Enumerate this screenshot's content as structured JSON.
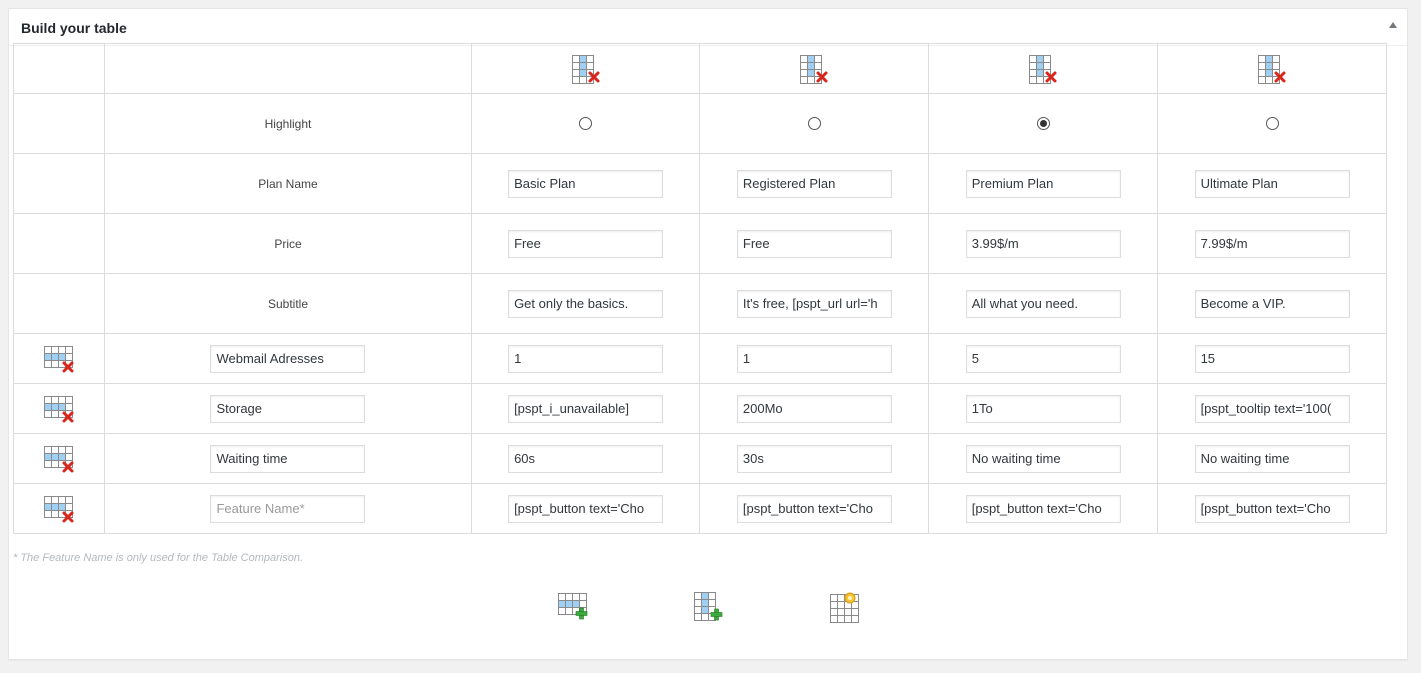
{
  "panel": {
    "title": "Build your table"
  },
  "rows": {
    "highlight": "Highlight",
    "plan_name": "Plan Name",
    "price": "Price",
    "subtitle": "Subtitle"
  },
  "plans": [
    {
      "name": "Basic Plan",
      "price": "Free",
      "subtitle": "Get only the basics.",
      "highlighted": false
    },
    {
      "name": "Registered Plan",
      "price": "Free",
      "subtitle": "It's free, [pspt_url url='h",
      "highlighted": false
    },
    {
      "name": "Premium Plan",
      "price": "3.99$/m",
      "subtitle": "All what you need.",
      "highlighted": true
    },
    {
      "name": "Ultimate Plan",
      "price": "7.99$/m",
      "subtitle": "Become a VIP.",
      "highlighted": false
    }
  ],
  "features": [
    {
      "name": "Webmail Adresses",
      "values": [
        "1",
        "1",
        "5",
        "15"
      ]
    },
    {
      "name": "Storage",
      "values": [
        "[pspt_i_unavailable]",
        "200Mo",
        "1To",
        "[pspt_tooltip text='100("
      ]
    },
    {
      "name": "Waiting time",
      "values": [
        "60s",
        "30s",
        "No waiting time",
        "No waiting time"
      ]
    },
    {
      "name": "",
      "placeholder": "Feature Name*",
      "values": [
        "[pspt_button text='Cho",
        "[pspt_button text='Cho",
        "[pspt_button text='Cho",
        "[pspt_button text='Cho"
      ]
    }
  ],
  "note": "* The Feature Name is only used for the Table Comparison.",
  "icons": {
    "remove_column": "delete-column-icon",
    "remove_row": "delete-row-icon",
    "add_row": "add-row-icon",
    "add_column": "add-column-icon",
    "table_settings": "table-settings-icon"
  },
  "colors": {
    "cell_blue": "#9fd0f3",
    "delete_red": "#d9261c",
    "add_green": "#3caa3c"
  }
}
